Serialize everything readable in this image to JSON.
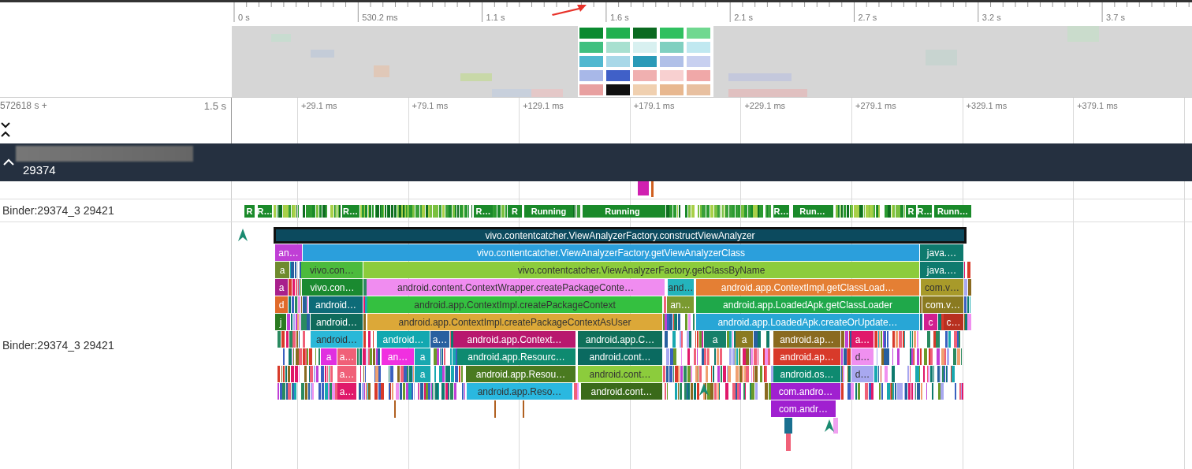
{
  "overview": {
    "ticks": [
      "0 s",
      "530.2 ms",
      "1.1 s",
      "1.6 s",
      "2.1 s",
      "2.7 s",
      "3.2 s",
      "3.7 s"
    ]
  },
  "timeline": {
    "offset_label": "572618 s +",
    "span_label": "1.5 s",
    "ticks": [
      "+29.1 ms",
      "+79.1 ms",
      "+129.1 ms",
      "+179.1 ms",
      "+229.1 ms",
      "+279.1 ms",
      "+329.1 ms",
      "+379.1 ms"
    ]
  },
  "process": {
    "expanded": true,
    "pid": "29374"
  },
  "thread_state_track": {
    "label": "Binder:29374_3 29421",
    "states": [
      {
        "label": "R"
      },
      {
        "label": "R…"
      },
      {
        "label": "R…"
      },
      {
        "label": "R…"
      },
      {
        "label": "R"
      },
      {
        "label": "Running"
      },
      {
        "label": "Running"
      },
      {
        "label": "R…"
      },
      {
        "label": "Run…"
      },
      {
        "label": "R"
      },
      {
        "label": "R…"
      },
      {
        "label": "Runn…"
      }
    ]
  },
  "slice_track": {
    "label": "Binder:29374_3 29421",
    "levels": [
      {
        "slices": [
          {
            "name": "vivo.contentcatcher.ViewAnalyzerFactory.constructViewAnalyzer",
            "color": "#0c4a5e",
            "selected": true
          }
        ]
      },
      {
        "slices": [
          {
            "name": "an…",
            "color": "#c03fd6",
            "selected": false
          },
          {
            "name": "vivo.contentcatcher.ViewAnalyzerFactory.getViewAnalyzerClass",
            "color": "#2b9fdc",
            "selected": false
          },
          {
            "name": "java.…",
            "color": "#0e7a6e",
            "selected": false
          }
        ]
      },
      {
        "slices": [
          {
            "name": "a",
            "color": "#6f8a2e",
            "selected": false
          },
          {
            "name": "vivo.con…",
            "color": "#4cbb3c",
            "selected": false
          },
          {
            "name": "vivo.contentcatcher.ViewAnalyzerFactory.getClassByName",
            "color": "#8ccc3c",
            "selected": false
          },
          {
            "name": "java.…",
            "color": "#0e7a6e",
            "selected": false
          }
        ]
      },
      {
        "slices": [
          {
            "name": "a",
            "color": "#a8208c",
            "selected": false
          },
          {
            "name": "vivo.con…",
            "color": "#1a8a30",
            "selected": false
          },
          {
            "name": "android.content.ContextWrapper.createPackageConte…",
            "color": "#f08cf0",
            "selected": false
          },
          {
            "name": "and…",
            "color": "#24b4bc",
            "selected": false
          },
          {
            "name": "android.app.ContextImpl.getClassLoad…",
            "color": "#e47f34",
            "selected": false
          },
          {
            "name": "com.v…",
            "color": "#a89a2a",
            "selected": false
          }
        ]
      },
      {
        "slices": [
          {
            "name": "d",
            "color": "#e06a2a",
            "selected": false
          },
          {
            "name": "android…",
            "color": "#0d6b78",
            "selected": false
          },
          {
            "name": "android.app.ContextImpl.createPackageContext",
            "color": "#34c040",
            "selected": false
          },
          {
            "name": "an…",
            "color": "#7a9a30",
            "selected": false
          },
          {
            "name": "android.app.LoadedApk.getClassLoader",
            "color": "#1fa84a",
            "selected": false
          },
          {
            "name": "com.v…",
            "color": "#8a7a20",
            "selected": false
          }
        ]
      },
      {
        "slices": [
          {
            "name": "j",
            "color": "#2a7a20",
            "selected": false
          },
          {
            "name": "android…",
            "color": "#0f6b5c",
            "selected": false
          },
          {
            "name": "android.app.ContextImpl.createPackageContextAsUser",
            "color": "#dca838",
            "selected": false
          },
          {
            "name": "android.app.LoadedApk.createOrUpdate…",
            "color": "#28a6d6",
            "selected": false
          },
          {
            "name": "c",
            "color": "#d02090",
            "selected": false
          },
          {
            "name": "c…",
            "color": "#b83020",
            "selected": false
          }
        ]
      },
      {
        "slices": [
          {
            "name": "android…",
            "color": "#2ab8d8",
            "selected": false
          },
          {
            "name": "android…",
            "color": "#12a8b0",
            "selected": false
          },
          {
            "name": "a…",
            "color": "#2860a0",
            "selected": false
          },
          {
            "name": "android.app.Context…",
            "color": "#b8186e",
            "selected": false
          },
          {
            "name": "android.app.C…",
            "color": "#10705a",
            "selected": false
          },
          {
            "name": "a",
            "color": "#16806a",
            "selected": false
          },
          {
            "name": "a",
            "color": "#8a7a20",
            "selected": false
          },
          {
            "name": "android.ap…",
            "color": "#8a6a20",
            "selected": false
          },
          {
            "name": "a…",
            "color": "#e0186a",
            "selected": false
          }
        ]
      },
      {
        "slices": [
          {
            "name": "a",
            "color": "#e030e0",
            "selected": false
          },
          {
            "name": "a…",
            "color": "#f06078",
            "selected": false
          },
          {
            "name": "an…",
            "color": "#f030e0",
            "selected": false
          },
          {
            "name": "a",
            "color": "#18a8b0",
            "selected": false
          },
          {
            "name": "android.app.Resourc…",
            "color": "#0e8a70",
            "selected": false
          },
          {
            "name": "android.cont…",
            "color": "#0a6a60",
            "selected": false
          },
          {
            "name": "android.ap…",
            "color": "#d83a2a",
            "selected": false
          },
          {
            "name": "d…",
            "color": "#f090f0",
            "selected": false
          }
        ]
      },
      {
        "slices": [
          {
            "name": "a…",
            "color": "#f06078",
            "selected": false
          },
          {
            "name": "a",
            "color": "#18a8b0",
            "selected": false
          },
          {
            "name": "android.app.Resou…",
            "color": "#4a7a20",
            "selected": false
          },
          {
            "name": "android.cont…",
            "color": "#8ccc3c",
            "selected": false
          },
          {
            "name": "android.os…",
            "color": "#0e8a70",
            "selected": false
          },
          {
            "name": "d…",
            "color": "#a8a8f0",
            "selected": false
          }
        ]
      },
      {
        "slices": [
          {
            "name": "a…",
            "color": "#e0186a",
            "selected": false
          },
          {
            "name": "android.app.Reso…",
            "color": "#2ab8e0",
            "selected": false
          },
          {
            "name": "android.cont…",
            "color": "#3a6a1a",
            "selected": false
          },
          {
            "name": "com.andro…",
            "color": "#a020d0",
            "selected": false
          }
        ]
      },
      {
        "slices": [
          {
            "name": "com.andr…",
            "color": "#a020d0",
            "selected": false
          }
        ]
      }
    ]
  }
}
